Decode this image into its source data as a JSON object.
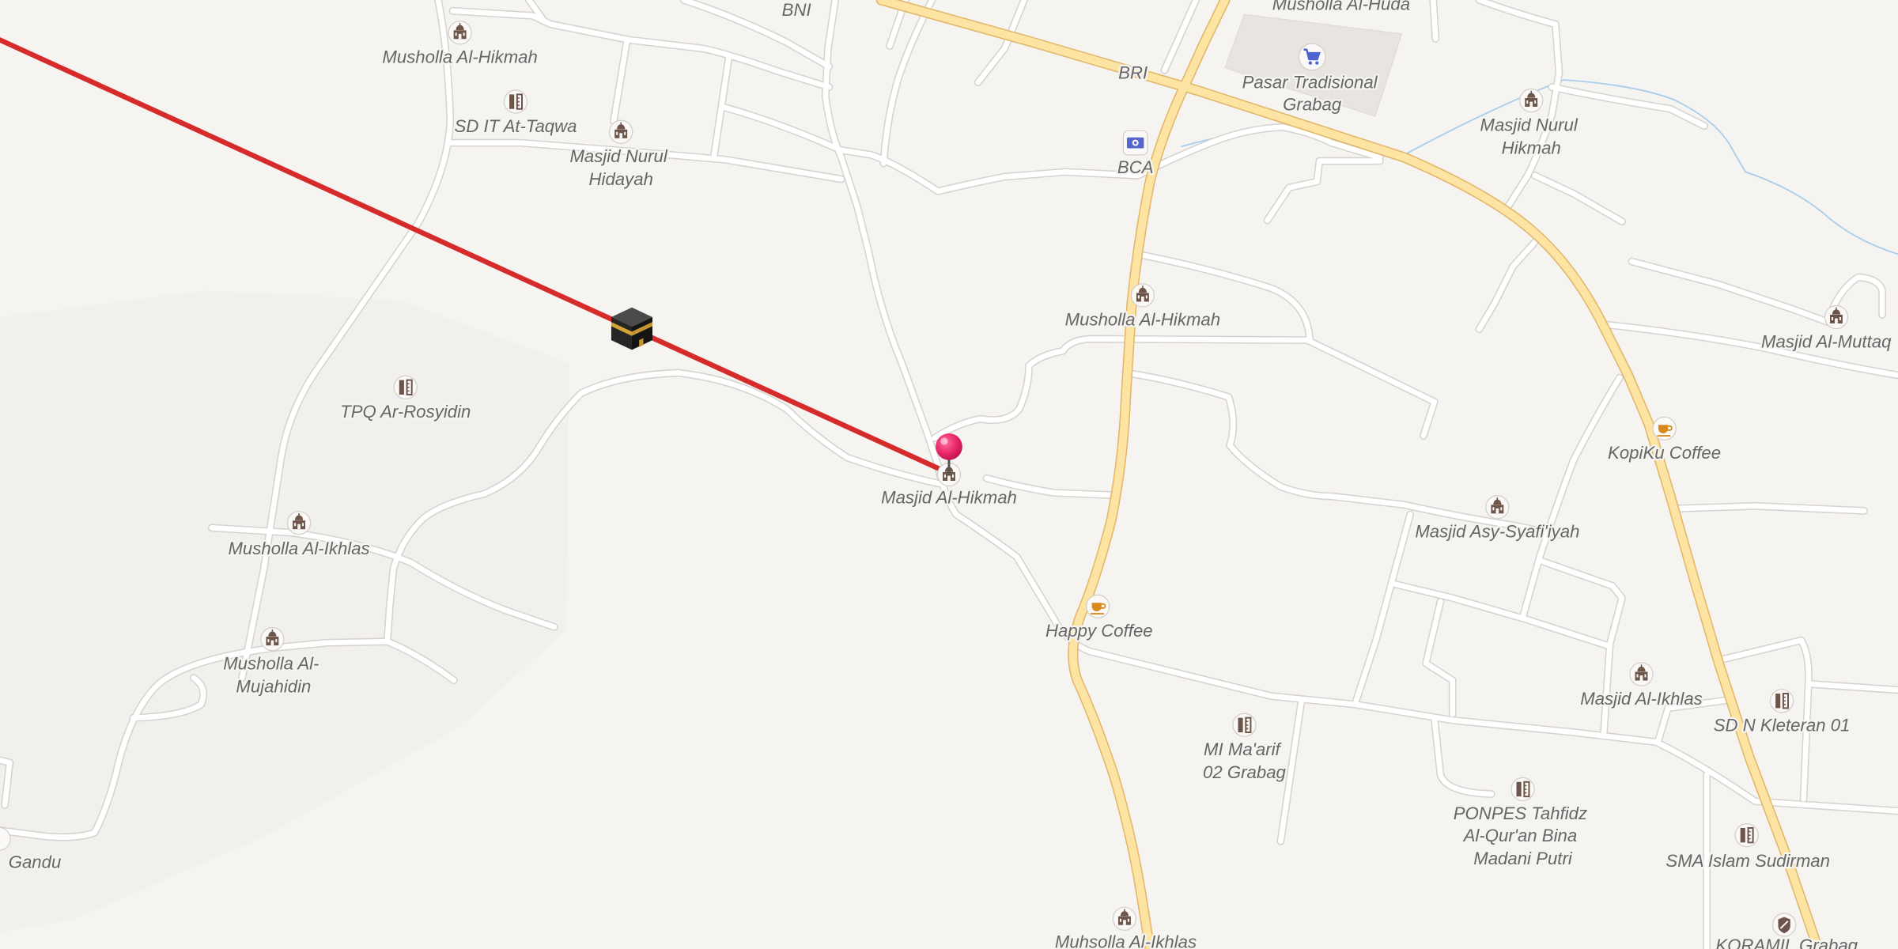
{
  "map": {
    "type": "street-map",
    "colors": {
      "background": "#f6f4f1",
      "minor_road": "#ffffff",
      "main_road": "#fde4a3",
      "qibla_line": "#d62b2b",
      "pin": "#e8286d",
      "water": "#a9cdec",
      "poi_icon": "#6e5549"
    }
  },
  "markers": {
    "kaaba": {
      "icon": "kaaba-icon"
    },
    "current_location": {
      "icon": "location-pin-icon"
    }
  },
  "pois": [
    {
      "icon": "mosque-icon",
      "lines": [
        "Musholla Al-Hikmah"
      ]
    },
    {
      "icon": "school-icon",
      "lines": [
        "SD IT At-Taqwa"
      ]
    },
    {
      "icon": "mosque-icon",
      "lines": [
        "Masjid Nurul",
        "Hidayah"
      ]
    },
    {
      "lines": [
        "BNI"
      ]
    },
    {
      "lines": [
        "Musholla Al-Huda"
      ]
    },
    {
      "icon": "shopping-cart-icon",
      "lines": [
        "Pasar Tradisional",
        "Grabag"
      ]
    },
    {
      "lines": [
        "BRI"
      ]
    },
    {
      "icon": "bank-icon",
      "lines": [
        "BCA"
      ]
    },
    {
      "icon": "mosque-icon",
      "lines": [
        "Masjid Nurul",
        "Hikmah"
      ]
    },
    {
      "icon": "mosque-icon",
      "lines": [
        "Musholla Al-Hikmah"
      ]
    },
    {
      "icon": "school-icon",
      "lines": [
        "TPQ Ar-Rosyidin"
      ]
    },
    {
      "icon": "mosque-icon",
      "lines": [
        "Masjid Al-Muttaq"
      ]
    },
    {
      "icon": "coffee-icon",
      "lines": [
        "KopiKu Coffee"
      ]
    },
    {
      "icon": "mosque-icon",
      "lines": [
        "Masjid Al-Hikmah"
      ]
    },
    {
      "icon": "mosque-icon",
      "lines": [
        "Masjid Asy-Syafi'iyah"
      ]
    },
    {
      "icon": "mosque-icon",
      "lines": [
        "Musholla Al-Ikhlas"
      ]
    },
    {
      "icon": "coffee-icon",
      "lines": [
        "Happy Coffee"
      ]
    },
    {
      "icon": "mosque-icon",
      "lines": [
        "Musholla Al-",
        "Mujahidin"
      ]
    },
    {
      "icon": "mosque-icon",
      "lines": [
        "Masjid Al-Ikhlas"
      ]
    },
    {
      "icon": "school-icon",
      "lines": [
        "SD N Kleteran 01"
      ]
    },
    {
      "icon": "school-icon",
      "lines": [
        "MI Ma'arif",
        "02 Grabag"
      ]
    },
    {
      "icon": "school-icon",
      "lines": [
        "PONPES Tahfidz",
        "Al-Qur'an Bina",
        "Madani Putri"
      ]
    },
    {
      "icon": "school-icon",
      "lines": [
        "SMA Islam Sudirman"
      ]
    },
    {
      "icon": "mosque-icon",
      "lines": [
        "Muhsolla Al-Ikhlas"
      ]
    },
    {
      "icon": "military-icon",
      "lines": [
        "KORAMIL Grabag"
      ]
    },
    {
      "lines": [
        "Gandu"
      ]
    }
  ]
}
